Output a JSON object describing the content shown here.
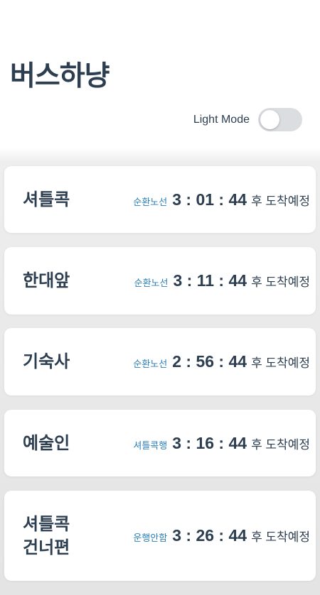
{
  "header": {
    "title": "버스하냥",
    "mode_label": "Light Mode",
    "mode_toggle_on": false
  },
  "colors": {
    "text": "#2c3e50",
    "route": "#2a7fb8",
    "toggle_track": "#dcdde1",
    "card": "#ffffff"
  },
  "stops": [
    {
      "name_lines": [
        "셔틀콕"
      ],
      "route": "순환노선",
      "time": "3 : 01 : 44",
      "suffix": "후 도착예정"
    },
    {
      "name_lines": [
        "한대앞"
      ],
      "route": "순환노선",
      "time": "3 : 11 : 44",
      "suffix": "후 도착예정"
    },
    {
      "name_lines": [
        "기숙사"
      ],
      "route": "순환노선",
      "time": "2 : 56 : 44",
      "suffix": "후 도착예정"
    },
    {
      "name_lines": [
        "예술인"
      ],
      "route": "셔틀콕행",
      "time": "3 : 16 : 44",
      "suffix": "후 도착예정"
    },
    {
      "name_lines": [
        "셔틀콕",
        "건너편"
      ],
      "route": "운행안함",
      "time": "3 : 26 : 44",
      "suffix": "후 도착예정"
    }
  ]
}
